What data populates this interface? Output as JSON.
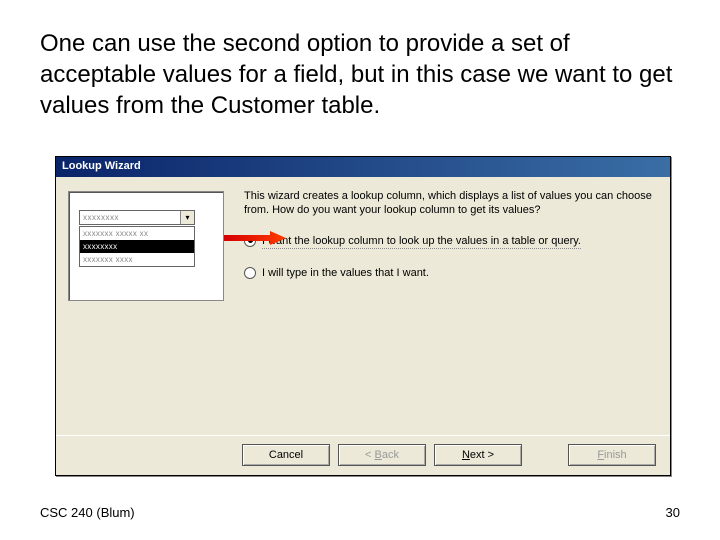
{
  "slide": {
    "body": "One can use the second option to provide a set of acceptable values for a field, but in this case we want to get values from the Customer table.",
    "footer_left": "CSC 240 (Blum)",
    "page_number": "30"
  },
  "wizard": {
    "title": "Lookup Wizard",
    "intro": "This wizard creates a lookup column, which displays a list of values you can choose from.  How do you want your lookup column to get its values?",
    "sample_combo": "xxxxxxxx",
    "sample_rows": [
      "xxxxxxx xxxxx xx",
      "xxxxxxxx",
      "xxxxxxx xxxx"
    ],
    "option1": "I want the lookup column to look up the values in a table or query.",
    "option2": "I will type in the values that I want.",
    "selected_option": 1,
    "buttons": {
      "cancel": "Cancel",
      "back_prefix": "< ",
      "back_accel": "B",
      "back_rest": "ack",
      "next_accel": "N",
      "next_rest": "ext >",
      "finish_accel": "F",
      "finish_rest": "inish"
    }
  }
}
